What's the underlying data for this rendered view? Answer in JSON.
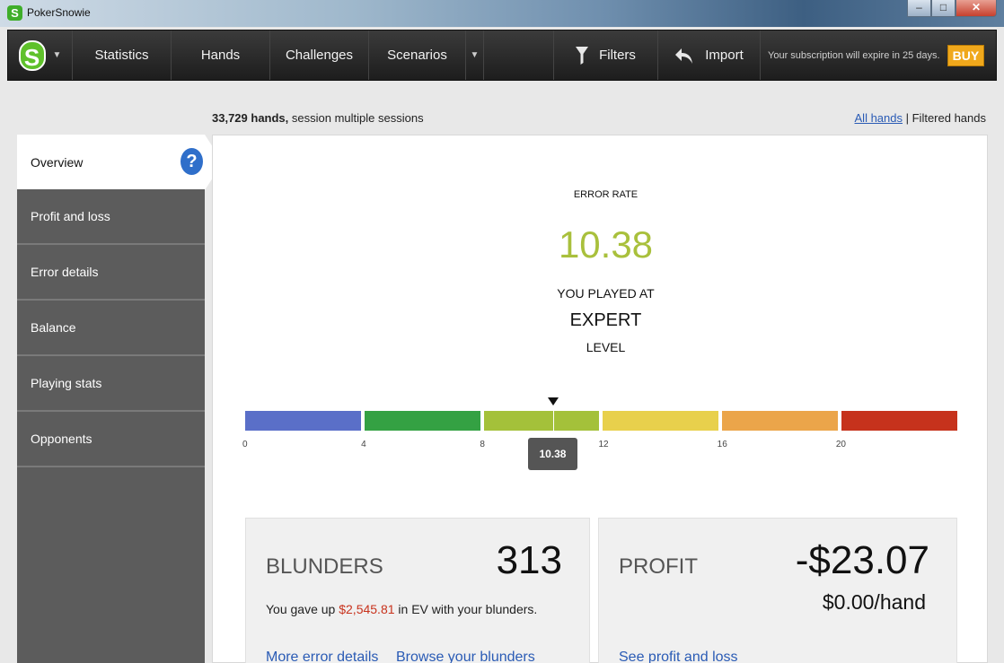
{
  "window": {
    "title": "PokerSnowie",
    "app_icon": "S"
  },
  "nav": {
    "logo": "S",
    "items": [
      "Statistics",
      "Hands",
      "Challenges",
      "Scenarios"
    ],
    "filters": "Filters",
    "import": "Import",
    "subscription": "Your subscription will expire in 25 days.",
    "buy": "BUY"
  },
  "info": {
    "hands_count": "33,729 hands,",
    "session": " session multiple sessions",
    "all_hands": "All hands",
    "separator": " | ",
    "filtered_hands": "Filtered hands"
  },
  "sidebar": {
    "items": [
      "Overview",
      "Profit and loss",
      "Error details",
      "Balance",
      "Playing stats",
      "Opponents"
    ],
    "active": "Overview"
  },
  "error_rate": {
    "label": "ERROR RATE",
    "value": "10.38",
    "played_at": "YOU PLAYED AT",
    "level": "EXPERT",
    "level_word": "LEVEL",
    "scale_ticks": [
      "0",
      "4",
      "8",
      "12",
      "16",
      "20"
    ],
    "scale_colors": [
      "#5a6fc8",
      "#34a143",
      "#a4c13a",
      "#e8d04c",
      "#eba54a",
      "#c6321c"
    ],
    "marker_value": 10.38,
    "scale_max": 24
  },
  "blunders": {
    "title": "BLUNDERS",
    "count": "313",
    "text_before": "You gave up ",
    "ev_amount": "$2,545.81",
    "text_after": " in EV with your blunders.",
    "link_more": "More error details",
    "link_browse": "Browse your blunders"
  },
  "profit": {
    "title": "PROFIT",
    "amount": "-$23.07",
    "per_hand": "$0.00/hand",
    "link": "See profit and loss"
  }
}
